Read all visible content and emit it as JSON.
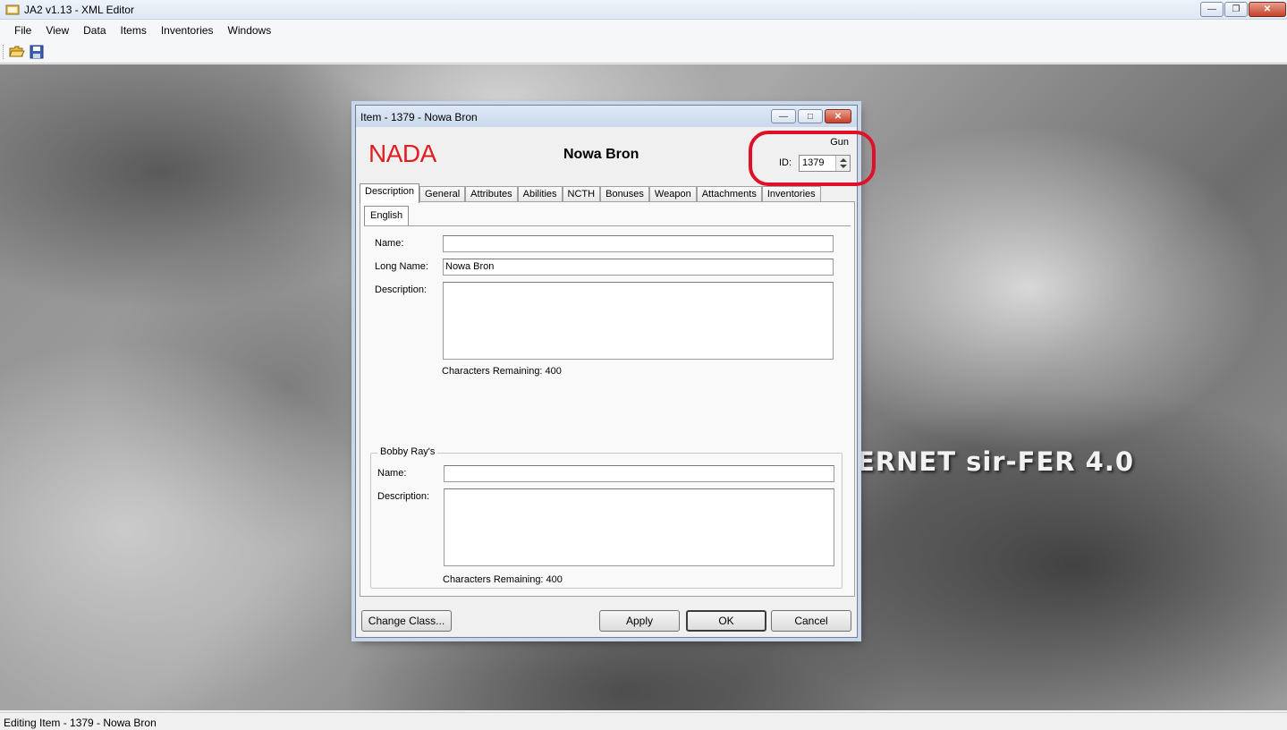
{
  "window": {
    "title": "JA2 v1.13 - XML Editor"
  },
  "menubar": {
    "items": [
      "File",
      "View",
      "Data",
      "Items",
      "Inventories",
      "Windows"
    ]
  },
  "toolbar": {
    "icons": [
      "open-folder-icon",
      "save-disk-icon"
    ]
  },
  "background": {
    "text": "ERNET sir-FER 4.0"
  },
  "dialog": {
    "title": "Item - 1379 - Nowa Bron",
    "class_logo": "NADA",
    "item_name": "Nowa Bron",
    "item_type": "Gun",
    "id_label": "ID:",
    "id_value": "1379",
    "tabs": [
      "Description",
      "General",
      "Attributes",
      "Abilities",
      "NCTH",
      "Bonuses",
      "Weapon",
      "Attachments",
      "Inventories"
    ],
    "active_tab": "Description",
    "language_tab": "English",
    "name_label": "Name:",
    "name_value": "",
    "long_name_label": "Long Name:",
    "long_name_value": "Nowa Bron",
    "description_label": "Description:",
    "description_value": "",
    "chars_remaining": "Characters Remaining:  400",
    "bobby": {
      "group_title": "Bobby Ray's",
      "name_label": "Name:",
      "name_value": "",
      "description_label": "Description:",
      "description_value": "",
      "chars_remaining": "Characters Remaining:  400"
    },
    "buttons": {
      "change_class": "Change Class...",
      "apply": "Apply",
      "ok": "OK",
      "cancel": "Cancel"
    }
  },
  "statusbar": {
    "text": "Editing Item - 1379 - Nowa Bron"
  },
  "colors": {
    "class_logo": "#e02020",
    "highlight": "#e0102a",
    "close_button": "#c6402b"
  }
}
